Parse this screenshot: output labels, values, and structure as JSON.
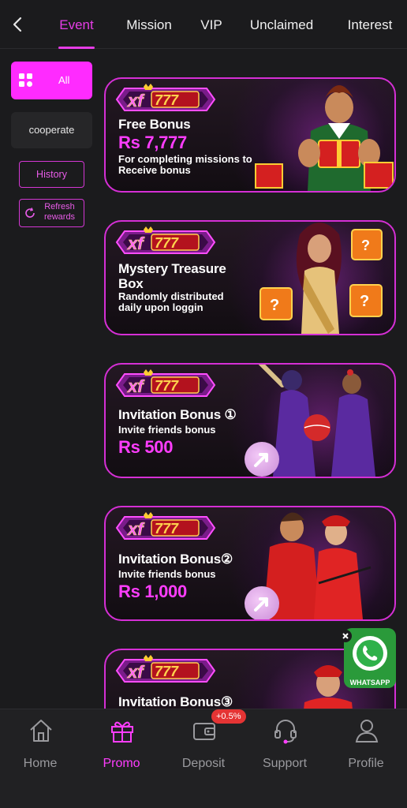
{
  "tabs": [
    {
      "label": "Event",
      "active": true
    },
    {
      "label": "Mission"
    },
    {
      "label": "VIP"
    },
    {
      "label": "Unclaimed"
    },
    {
      "label": "Interest"
    }
  ],
  "sidebar": {
    "all_label": "All",
    "cooperate_label": "cooperate",
    "history_label": "History",
    "refresh_label": "Refresh rewards"
  },
  "banners": [
    {
      "title": "Free Bonus",
      "amount": "Rs 7,777",
      "subtitle": "For completing missions to Receive bonus"
    },
    {
      "title": "Mystery Treasure Box",
      "subtitle": "Randomly distributed daily upon loggin"
    },
    {
      "title": "Invitation Bonus ①",
      "subtitle": "Invite friends bonus",
      "amount": "Rs 500"
    },
    {
      "title": "Invitation Bonus②",
      "subtitle": "Invite friends bonus",
      "amount": "Rs 1,000"
    },
    {
      "title": "Invitation Bonus③"
    }
  ],
  "logo_text": "xf777",
  "whatsapp_label": "WHATSAPP",
  "bottom_nav": [
    {
      "label": "Home"
    },
    {
      "label": "Promo",
      "active": true
    },
    {
      "label": "Deposit",
      "badge": "+0.5%"
    },
    {
      "label": "Support"
    },
    {
      "label": "Profile"
    }
  ],
  "colors": {
    "accent": "#ff2bff",
    "background": "#1b1b1d",
    "badge": "#e53434"
  }
}
